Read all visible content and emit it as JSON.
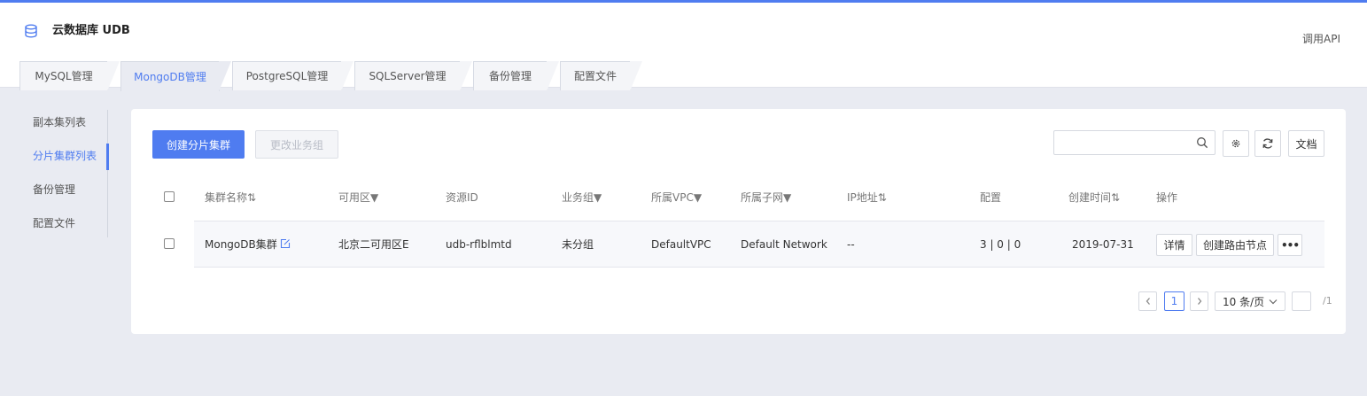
{
  "app": {
    "title": "云数据库 UDB",
    "api_link": "调用API"
  },
  "tabs": [
    {
      "label": "MySQL管理"
    },
    {
      "label": "MongoDB管理"
    },
    {
      "label": "PostgreSQL管理"
    },
    {
      "label": "SQLServer管理"
    },
    {
      "label": "备份管理"
    },
    {
      "label": "配置文件"
    }
  ],
  "active_tab": "MongoDB管理",
  "sidebar": {
    "items": [
      {
        "label": "副本集列表"
      },
      {
        "label": "分片集群列表"
      },
      {
        "label": "备份管理"
      },
      {
        "label": "配置文件"
      }
    ],
    "active": "分片集群列表"
  },
  "toolbar": {
    "create_label": "创建分片集群",
    "change_group_label": "更改业务组",
    "search_placeholder": "",
    "docs_label": "文档"
  },
  "table": {
    "headers": {
      "name": "集群名称⇅",
      "zone": "可用区▼",
      "resource_id": "资源ID",
      "group": "业务组▼",
      "vpc": "所属VPC▼",
      "subnet": "所属子网▼",
      "ip": "IP地址⇅",
      "config": "配置",
      "created": "创建时间⇅",
      "actions": "操作"
    },
    "rows": [
      {
        "name": "MongoDB集群",
        "zone": "北京二可用区E",
        "resource_id": "udb-rflblmtd",
        "group": "未分组",
        "vpc": "DefaultVPC",
        "subnet": "Default Network",
        "ip": "--",
        "config": "3 | 0 | 0",
        "created": "2019-07-31",
        "action_detail": "详情",
        "action_create_router": "创建路由节点",
        "action_more": "•••"
      }
    ]
  },
  "pagination": {
    "current_page": "1",
    "page_size_label": "10 条/页",
    "total_pages": "/1"
  },
  "colors": {
    "accent": "#4f7cf0",
    "background": "#e9ebf2"
  }
}
